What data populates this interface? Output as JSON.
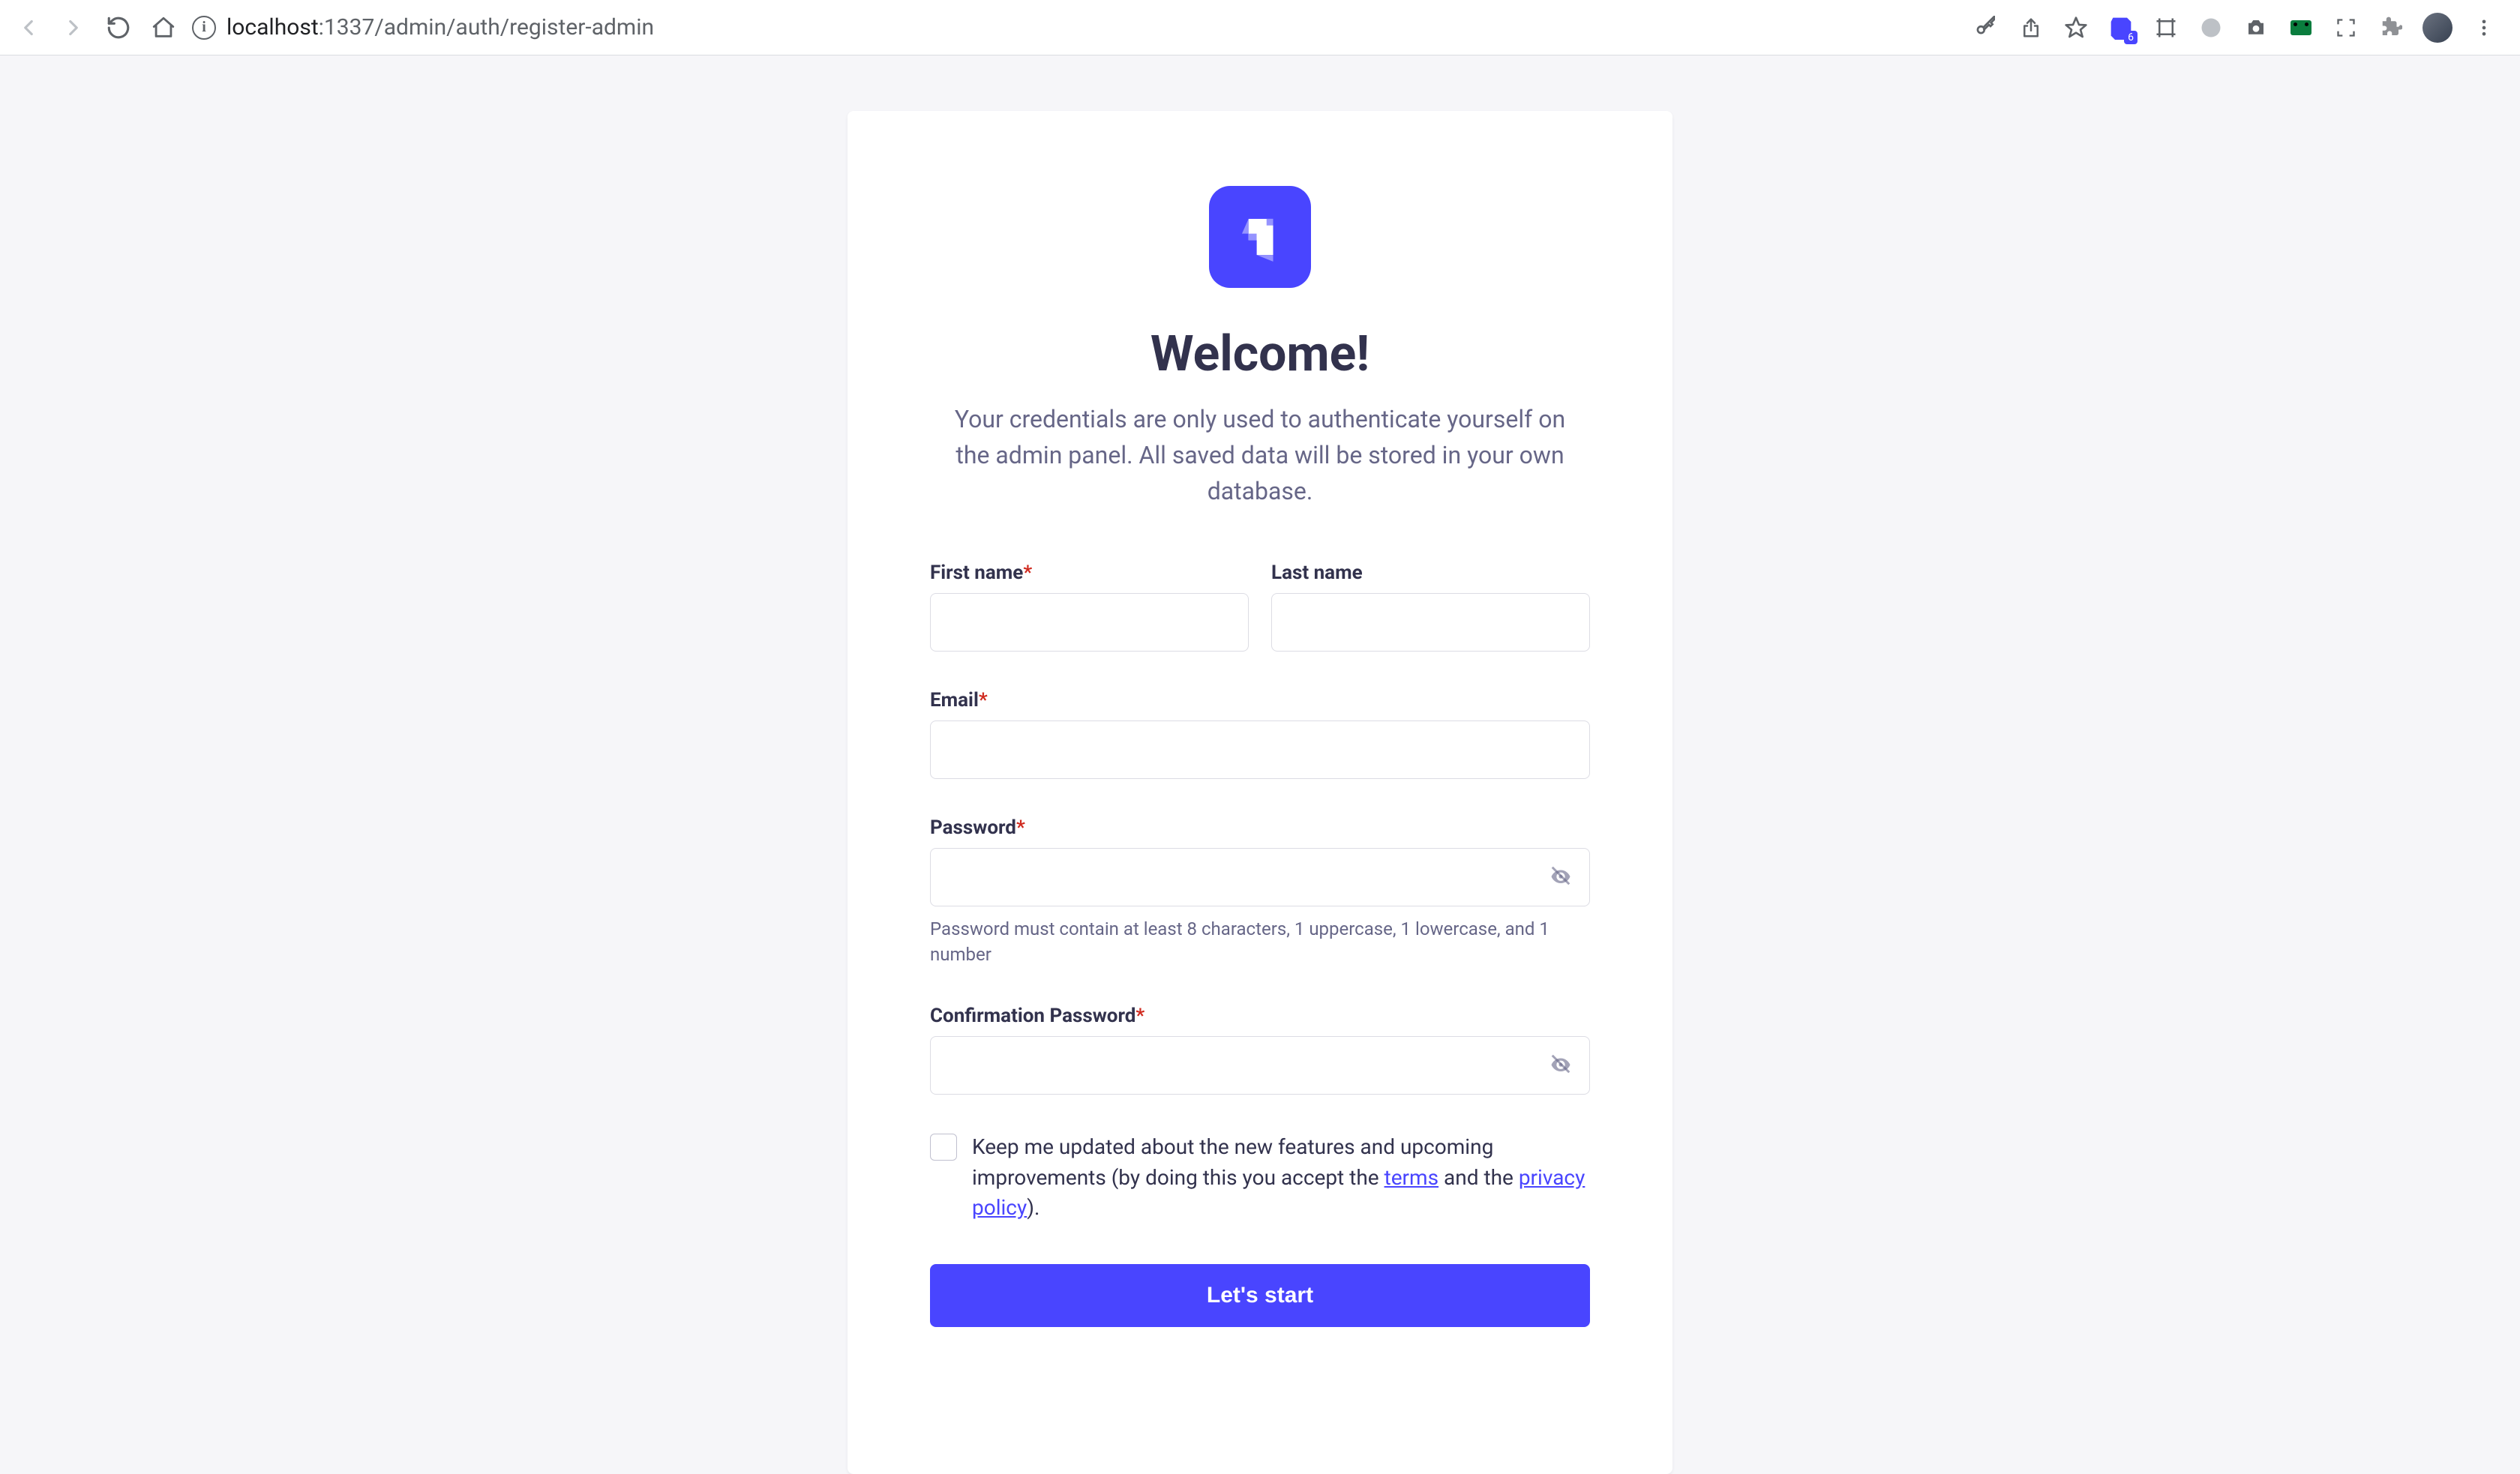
{
  "browser": {
    "url_host": "localhost",
    "url_port_path": ":1337/admin/auth/register-admin",
    "ext_badge": "6"
  },
  "page": {
    "title": "Welcome!",
    "subtitle": "Your credentials are only used to authenticate yourself on the admin panel. All saved data will be stored in your own database."
  },
  "form": {
    "first_name_label": "First name",
    "last_name_label": "Last name",
    "email_label": "Email",
    "password_label": "Password",
    "password_hint": "Password must contain at least 8 characters, 1 uppercase, 1 lowercase, and 1 number",
    "confirm_label": "Confirmation Password",
    "checkbox_text_1": "Keep me updated about the new features and upcoming improvements (by doing this you accept the ",
    "terms_link": "terms",
    "checkbox_text_2": " and the ",
    "privacy_link": "privacy policy",
    "checkbox_text_3": ").",
    "submit_label": "Let's start",
    "required_mark": "*"
  },
  "colors": {
    "primary": "#4945ff",
    "text_dark": "#32324d",
    "text_muted": "#666687",
    "border": "#dcdce4",
    "danger": "#d02b20",
    "page_bg": "#f6f6f9"
  }
}
